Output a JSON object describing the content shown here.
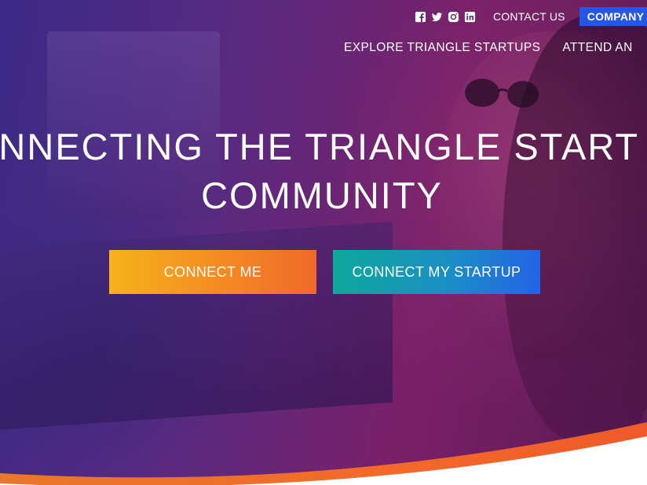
{
  "util_bar": {
    "social_icons": [
      "facebook-icon",
      "twitter-icon",
      "instagram-icon",
      "linkedin-icon"
    ],
    "contact_label": "CONTACT US",
    "company_label": "COMPANY"
  },
  "nav": {
    "items": [
      {
        "label": "EXPLORE TRIANGLE STARTUPS"
      },
      {
        "label": "ATTEND AN"
      }
    ]
  },
  "hero": {
    "headline_line1": "ONNECTING THE TRIANGLE START",
    "headline_line2": "COMMUNITY"
  },
  "cta": {
    "connect_me": "CONNECT ME",
    "connect_startup": "CONNECT MY STARTUP"
  },
  "colors": {
    "company_button": "#2456e8",
    "cta_me_start": "#f7b21b",
    "cta_me_end": "#ef6a2a",
    "cta_startup_start": "#0ea89a",
    "cta_startup_end": "#2563e6",
    "accent_curve": "#f26a2a"
  }
}
